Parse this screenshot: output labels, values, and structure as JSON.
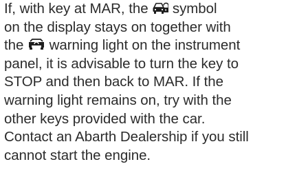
{
  "text": {
    "line1_a": "If, with key at MAR, the ",
    "line1_b": " symbol",
    "line2": "on the display stays on together with",
    "line3_a": "the ",
    "line3_b": " warning light on the instrument",
    "line4": "panel, it is advisable to turn the key to",
    "line5": "STOP and then back to MAR. If the",
    "line6": "warning light remains on, try with the",
    "line7": "other keys provided with the car.",
    "line8": "Contact an Abarth Dealership if you still",
    "line9": "cannot start the engine."
  },
  "icons": {
    "display_symbol": "car-key-lock-icon",
    "warning_light": "immobilizer-warning-light-icon"
  },
  "colors": {
    "text": "#2b2b2b",
    "icon": "#1e1e1e",
    "background": "#ffffff"
  }
}
